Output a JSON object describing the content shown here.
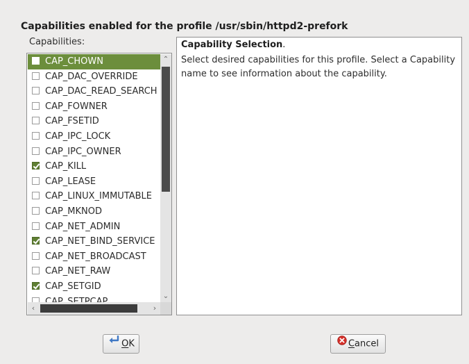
{
  "dialog": {
    "heading": "Capabilities enabled for the profile /usr/sbin/httpd2-prefork",
    "list_label": "Capabilities:"
  },
  "capabilities": [
    {
      "name": "CAP_CHOWN",
      "checked": false,
      "selected": true
    },
    {
      "name": "CAP_DAC_OVERRIDE",
      "checked": false,
      "selected": false
    },
    {
      "name": "CAP_DAC_READ_SEARCH",
      "checked": false,
      "selected": false
    },
    {
      "name": "CAP_FOWNER",
      "checked": false,
      "selected": false
    },
    {
      "name": "CAP_FSETID",
      "checked": false,
      "selected": false
    },
    {
      "name": "CAP_IPC_LOCK",
      "checked": false,
      "selected": false
    },
    {
      "name": "CAP_IPC_OWNER",
      "checked": false,
      "selected": false
    },
    {
      "name": "CAP_KILL",
      "checked": true,
      "selected": false
    },
    {
      "name": "CAP_LEASE",
      "checked": false,
      "selected": false
    },
    {
      "name": "CAP_LINUX_IMMUTABLE",
      "checked": false,
      "selected": false
    },
    {
      "name": "CAP_MKNOD",
      "checked": false,
      "selected": false
    },
    {
      "name": "CAP_NET_ADMIN",
      "checked": false,
      "selected": false
    },
    {
      "name": "CAP_NET_BIND_SERVICE",
      "checked": true,
      "selected": false
    },
    {
      "name": "CAP_NET_BROADCAST",
      "checked": false,
      "selected": false
    },
    {
      "name": "CAP_NET_RAW",
      "checked": false,
      "selected": false
    },
    {
      "name": "CAP_SETGID",
      "checked": true,
      "selected": false
    },
    {
      "name": "CAP_SETPCAP",
      "checked": false,
      "selected": false
    }
  ],
  "info": {
    "title": "Capability Selection",
    "title_suffix": ".",
    "text": "Select desired capabilities for this profile. Select a Capability name to see information about the capability."
  },
  "buttons": {
    "ok_mnemonic": "O",
    "ok_rest": "K",
    "cancel_mnemonic": "C",
    "cancel_rest": "ancel"
  },
  "icons": {
    "ok": "enter-arrow-icon",
    "cancel": "cancel-icon",
    "scroll_up": "chevron-up-icon",
    "scroll_down": "chevron-down-icon",
    "scroll_left": "chevron-left-icon",
    "scroll_right": "chevron-right-icon"
  },
  "colors": {
    "selection": "#6c8e3c",
    "checkbox_checked": "#5f7f33",
    "cancel_icon": "#d6302a",
    "ok_icon": "#3f78c4"
  }
}
